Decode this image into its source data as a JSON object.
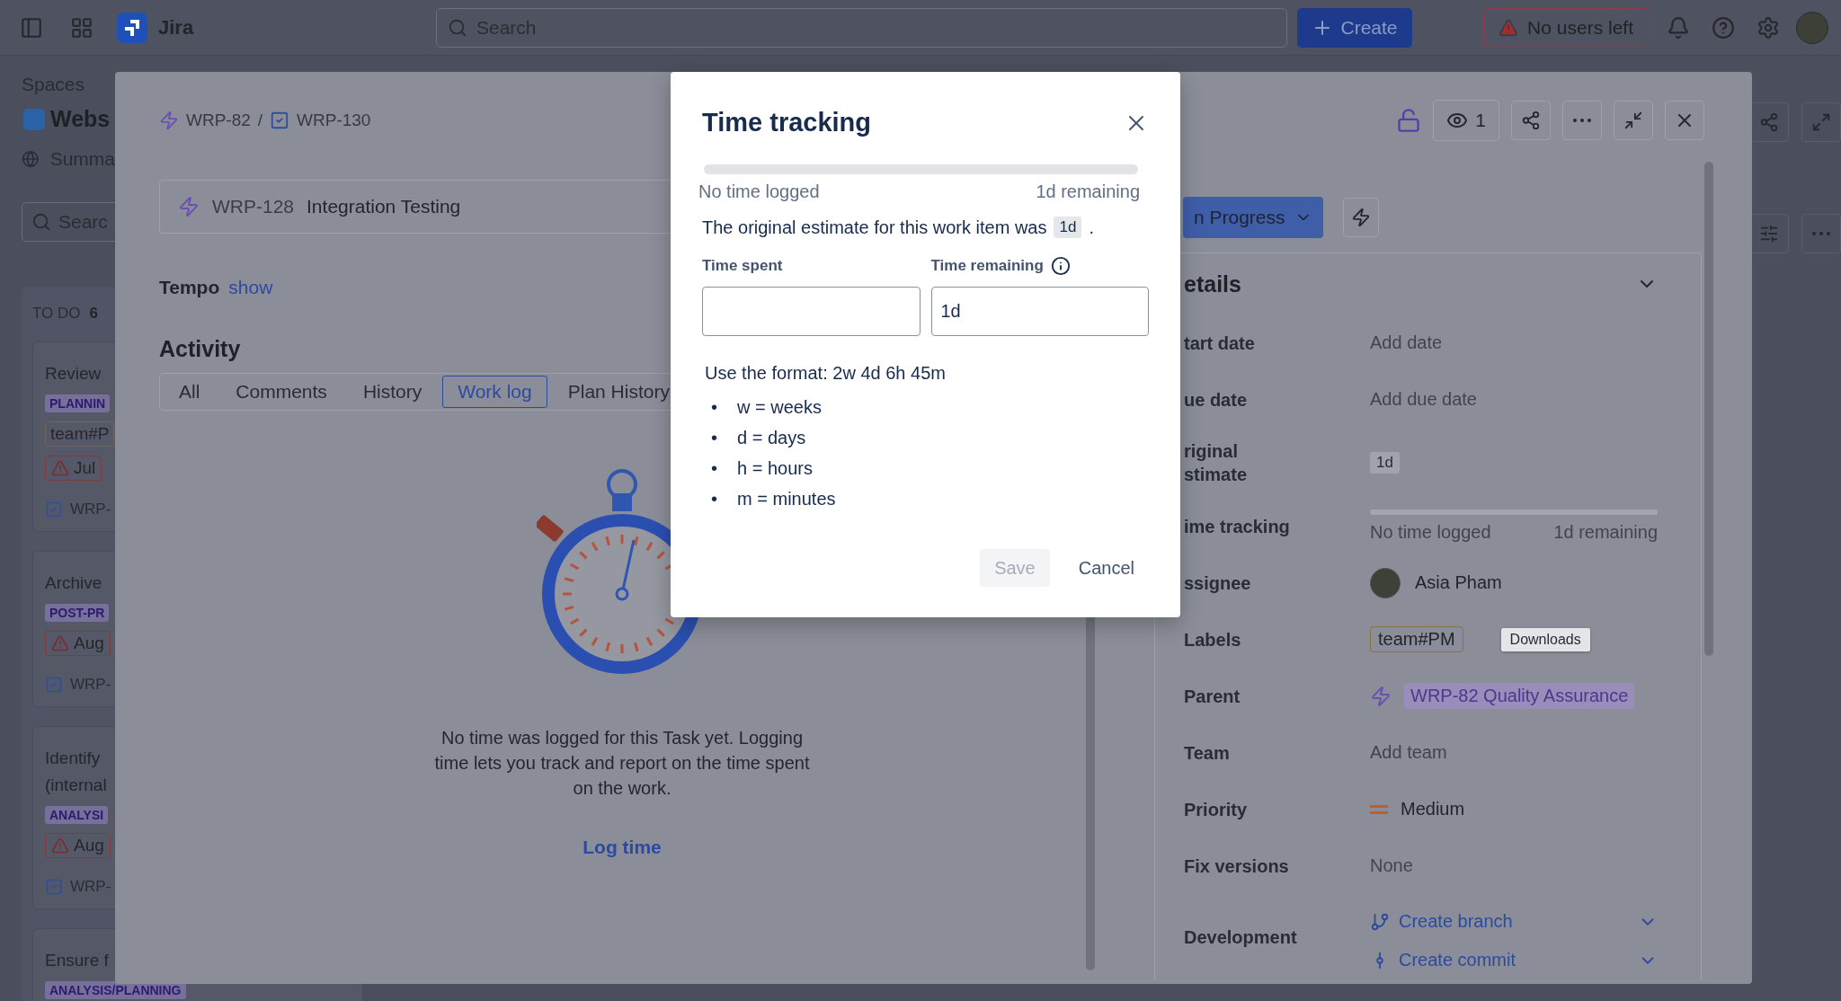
{
  "top_bar": {
    "product": "Jira",
    "search": {
      "placeholder": "Search"
    },
    "create": "Create",
    "alert": "No users left"
  },
  "sidebar": {
    "heading": "Spaces",
    "space": "Webs",
    "nav_item": "Summa",
    "search": {
      "placeholder": "Searc"
    }
  },
  "board": {
    "column": {
      "title": "TO DO",
      "count": "6"
    },
    "cards": [
      {
        "title_lines": [
          "Review"
        ],
        "tag": "PLANNIN",
        "label": "team#P",
        "due": "Jul",
        "key": "WRP-"
      },
      {
        "title_lines": [
          "Archive"
        ],
        "tag": "POST-PR",
        "due": "Aug",
        "key": "WRP-"
      },
      {
        "title_lines": [
          "Identify",
          "(internal"
        ],
        "tag": "ANALYSI",
        "due": "Aug",
        "key": "WRP-"
      },
      {
        "title_lines": [
          "Ensure f"
        ],
        "tag": "ANALYSIS/PLANNING"
      }
    ]
  },
  "issue": {
    "breadcrumb": [
      {
        "kind": "epic",
        "key": "WRP-82"
      },
      {
        "kind": "task",
        "key": "WRP-130"
      }
    ],
    "breadcrumb_separator": "/",
    "linked_item": {
      "key": "WRP-128",
      "summary": "Integration Testing"
    },
    "tempo": {
      "label": "Tempo",
      "link": "show"
    },
    "activity": {
      "heading": "Activity",
      "tabs": [
        {
          "label": "All",
          "selected": false
        },
        {
          "label": "Comments",
          "selected": false
        },
        {
          "label": "History",
          "selected": false
        },
        {
          "label": "Work log",
          "selected": true
        },
        {
          "label": "Plan History",
          "selected": false
        }
      ]
    },
    "empty_state": {
      "message": "No time was logged for this Task yet. Logging time lets you track and report on the time spent on the work.",
      "action": "Log time"
    },
    "watchers": "1",
    "status": "n Progress",
    "details": {
      "heading": "etails",
      "fields": [
        {
          "label": [
            "tart date"
          ],
          "kind": "empty",
          "value": "Add date"
        },
        {
          "label": [
            "ue date"
          ],
          "kind": "empty",
          "value": "Add due date"
        },
        {
          "label": [
            "riginal",
            "stimate"
          ],
          "kind": "chip",
          "value": "1d"
        },
        {
          "label": [
            "ime tracking"
          ],
          "kind": "tracking",
          "level": 0,
          "logged": "No time logged",
          "remaining": "1d remaining"
        },
        {
          "label": [
            "ssignee"
          ],
          "kind": "user",
          "value": "Asia Pham"
        },
        {
          "label": [
            "Labels"
          ],
          "kind": "tag",
          "value": "team#PM",
          "tooltip": "Downloads"
        },
        {
          "label": [
            "Parent"
          ],
          "kind": "parent",
          "value": "WRP-82 Quality Assurance"
        },
        {
          "label": [
            "Team"
          ],
          "kind": "empty",
          "value": "Add team"
        },
        {
          "label": [
            "Priority"
          ],
          "kind": "priority",
          "value": "Medium"
        },
        {
          "label": [
            "Fix versions"
          ],
          "kind": "empty",
          "value": "None"
        },
        {
          "label": [
            "Development"
          ],
          "kind": "development",
          "actions": [
            {
              "kind": "branch",
              "label": "Create branch"
            },
            {
              "kind": "commit",
              "label": "Create commit"
            }
          ]
        }
      ]
    }
  },
  "dialog": {
    "title": "Time tracking",
    "tracking": {
      "level": 0,
      "logged": "No time logged",
      "remaining": "1d remaining"
    },
    "estimate_text": "The original estimate for this work item was",
    "estimate": "1d",
    "estimate_end": ".",
    "fields": [
      {
        "label": "Time spent",
        "info": false
      },
      {
        "label": "Time remaining",
        "value": "1d",
        "info": true
      }
    ],
    "format_hint": "Use the format: 2w 4d 6h 45m",
    "units": [
      {
        "marker": "•",
        "text": "w = weeks"
      },
      {
        "marker": "•",
        "text": "d = days"
      },
      {
        "marker": "•",
        "text": "h = hours"
      },
      {
        "marker": "•",
        "text": "m = minutes"
      }
    ],
    "buttons": [
      {
        "label": "Save",
        "kind": "primary",
        "disabled": true
      },
      {
        "label": "Cancel",
        "kind": "subtle",
        "disabled": false
      }
    ]
  }
}
